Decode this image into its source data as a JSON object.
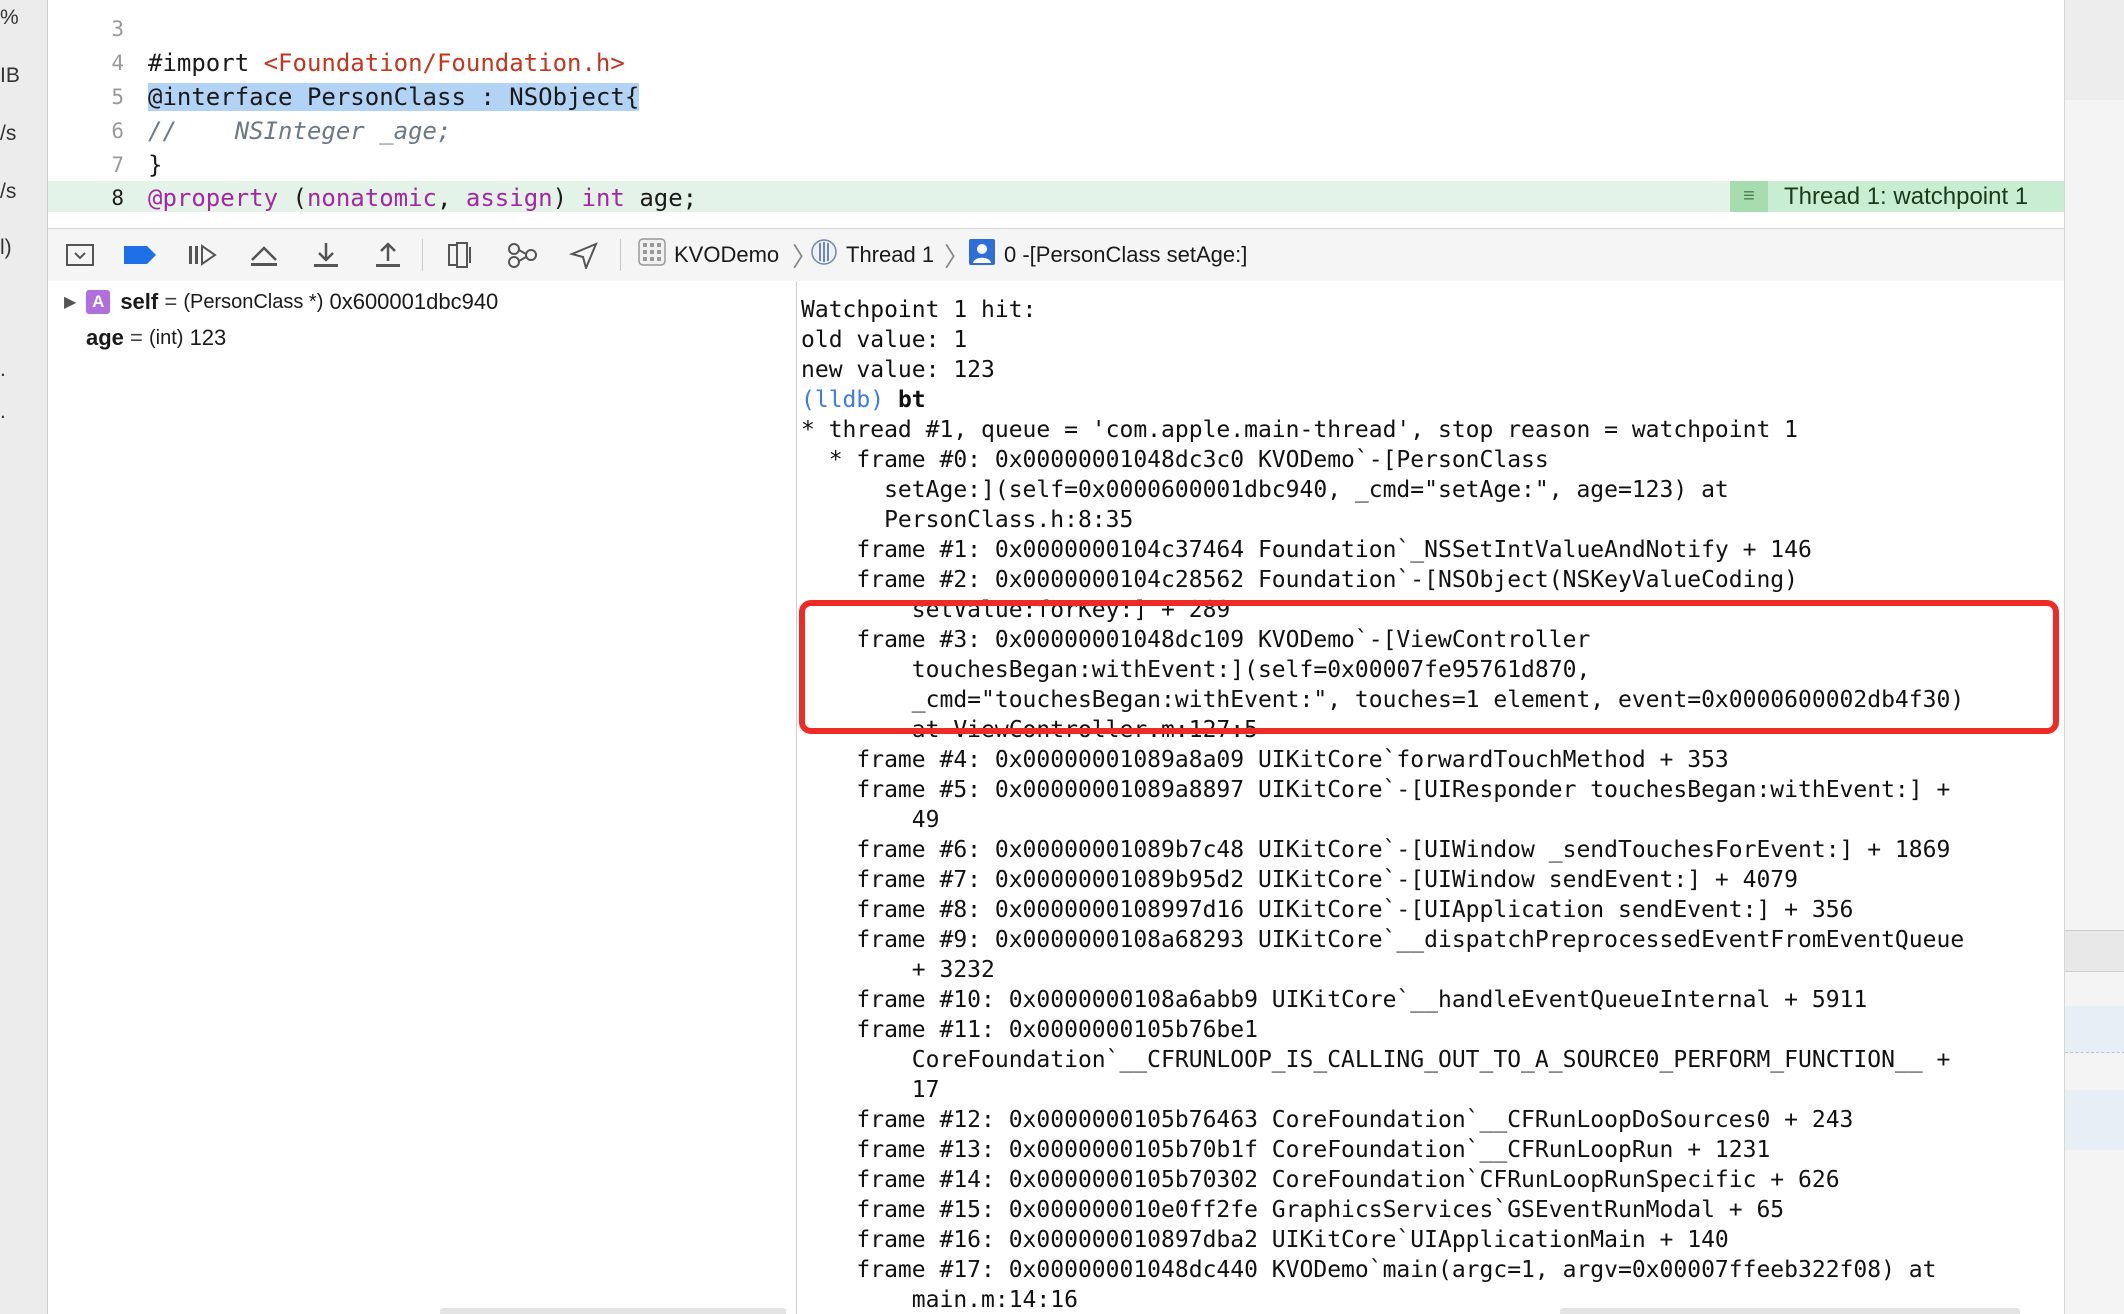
{
  "left_gutter": {
    "glyphs": [
      "%",
      "IB",
      "/s",
      "/s",
      "l)",
      ".",
      "."
    ]
  },
  "editor": {
    "lines": [
      {
        "num": "3",
        "segments": [
          {
            "text": "",
            "cls": ""
          }
        ]
      },
      {
        "num": "4",
        "segments": [
          {
            "text": "#import ",
            "cls": ""
          },
          {
            "text": "<Foundation/Foundation.h>",
            "cls": "str"
          }
        ]
      },
      {
        "num": "5",
        "segments": [
          {
            "text": "@interface",
            "cls": "hl kw-dark"
          },
          {
            "text": " PersonClass : NSObject{",
            "cls": "hl"
          }
        ]
      },
      {
        "num": "6",
        "segments": [
          {
            "text": "//    NSInteger _age;",
            "cls": "cmt"
          }
        ]
      },
      {
        "num": "7",
        "segments": [
          {
            "text": "}",
            "cls": ""
          }
        ]
      },
      {
        "num": "8",
        "segments": [
          {
            "text": "@property",
            "cls": "kw"
          },
          {
            "text": " (",
            "cls": ""
          },
          {
            "text": "nonatomic",
            "cls": "kw"
          },
          {
            "text": ", ",
            "cls": ""
          },
          {
            "text": "assign",
            "cls": "kw"
          },
          {
            "text": ") ",
            "cls": ""
          },
          {
            "text": "int",
            "cls": "kw"
          },
          {
            "text": " age;",
            "cls": ""
          }
        ]
      }
    ],
    "thread_badge": "Thread 1: watchpoint 1"
  },
  "toolbar": {
    "crumbs": {
      "app": "KVODemo",
      "thread": "Thread 1",
      "frame": "0 -[PersonClass setAge:]"
    }
  },
  "variables": [
    {
      "name": "self",
      "eq": " = ",
      "type": "(PersonClass *)",
      "value": " 0x600001dbc940",
      "expandable": true
    },
    {
      "name": "age",
      "eq": " = ",
      "type": "(int)",
      "value": " 123",
      "expandable": false
    }
  ],
  "console": {
    "lines": [
      "Watchpoint 1 hit:",
      "old value: 1",
      "new value: 123",
      "@@PROMPT@@",
      "* thread #1, queue = 'com.apple.main-thread', stop reason = watchpoint 1",
      "  * frame #0: 0x00000001048dc3c0 KVODemo`-[PersonClass",
      "      setAge:](self=0x0000600001dbc940, _cmd=\"setAge:\", age=123) at",
      "      PersonClass.h:8:35",
      "    frame #1: 0x0000000104c37464 Foundation`_NSSetIntValueAndNotify + 146",
      "    frame #2: 0x0000000104c28562 Foundation`-[NSObject(NSKeyValueCoding)",
      "        setValue:forKey:] + 289",
      "    frame #3: 0x00000001048dc109 KVODemo`-[ViewController",
      "        touchesBegan:withEvent:](self=0x00007fe95761d870,",
      "        _cmd=\"touchesBegan:withEvent:\", touches=1 element, event=0x0000600002db4f30)",
      "        at ViewController.m:127:5",
      "    frame #4: 0x00000001089a8a09 UIKitCore`forwardTouchMethod + 353",
      "    frame #5: 0x00000001089a8897 UIKitCore`-[UIResponder touchesBegan:withEvent:] +",
      "        49",
      "    frame #6: 0x00000001089b7c48 UIKitCore`-[UIWindow _sendTouchesForEvent:] + 1869",
      "    frame #7: 0x00000001089b95d2 UIKitCore`-[UIWindow sendEvent:] + 4079",
      "    frame #8: 0x0000000108997d16 UIKitCore`-[UIApplication sendEvent:] + 356",
      "    frame #9: 0x0000000108a68293 UIKitCore`__dispatchPreprocessedEventFromEventQueue",
      "        + 3232",
      "    frame #10: 0x0000000108a6abb9 UIKitCore`__handleEventQueueInternal + 5911",
      "    frame #11: 0x0000000105b76be1",
      "        CoreFoundation`__CFRUNLOOP_IS_CALLING_OUT_TO_A_SOURCE0_PERFORM_FUNCTION__ +",
      "        17",
      "    frame #12: 0x0000000105b76463 CoreFoundation`__CFRunLoopDoSources0 + 243",
      "    frame #13: 0x0000000105b70b1f CoreFoundation`__CFRunLoopRun + 1231",
      "    frame #14: 0x0000000105b70302 CoreFoundation`CFRunLoopRunSpecific + 626",
      "    frame #15: 0x000000010e0ff2fe GraphicsServices`GSEventRunModal + 65",
      "    frame #16: 0x000000010897dba2 UIKitCore`UIApplicationMain + 140",
      "    frame #17: 0x00000001048dc440 KVODemo`main(argc=1, argv=0x00007ffeeb322f08) at",
      "        main.m:14:16"
    ],
    "prompt": "(lldb)",
    "command": "bt"
  }
}
